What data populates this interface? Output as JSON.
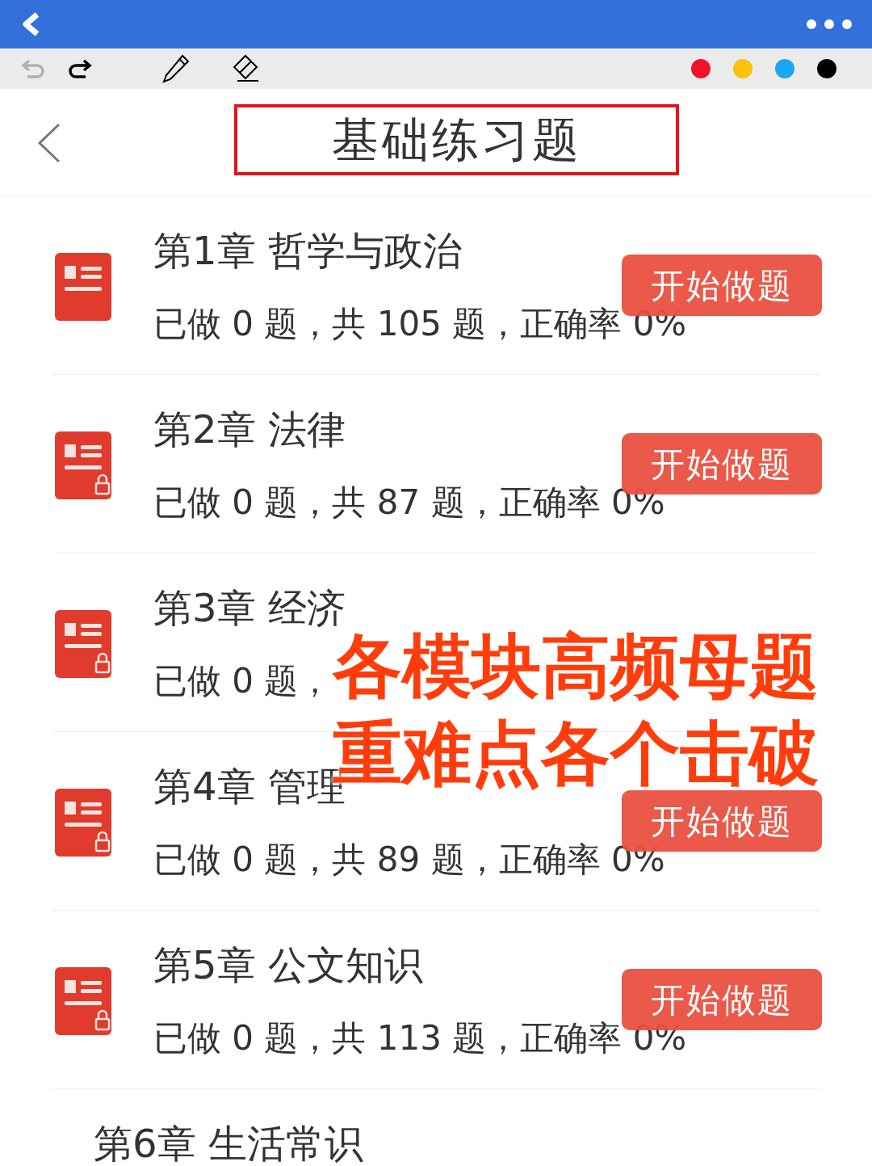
{
  "pen_colors": [
    {
      "color": "#f3102a"
    },
    {
      "color": "#fcc10a"
    },
    {
      "color": "#1aa6f0"
    },
    {
      "color": "#000000"
    }
  ],
  "header": {
    "title": "基础练习题",
    "highlighted": true
  },
  "chapters": [
    {
      "title": "第1章 哲学与政治",
      "stats": "已做 0 题，共 105 题，正确率 0%",
      "locked": false,
      "button": "开始做题"
    },
    {
      "title": "第2章 法律",
      "stats": "已做 0 题，共 87 题，正确率 0%",
      "locked": true,
      "button": "开始做题"
    },
    {
      "title": "第3章 经济",
      "stats": "已做 0 题，",
      "locked": true
    },
    {
      "title": "第4章 管理",
      "stats": "已做 0 题，共 89 题，正确率 0%",
      "locked": true,
      "button": "开始做题"
    },
    {
      "title": "第5章 公文知识",
      "stats": "已做 0 题，共 113 题，正确率 0%",
      "locked": true,
      "button": "开始做题"
    },
    {
      "title": "第6章 生活常识"
    }
  ],
  "overlay": {
    "lines": [
      "各模块高频母题",
      "重难点各个击破"
    ]
  }
}
